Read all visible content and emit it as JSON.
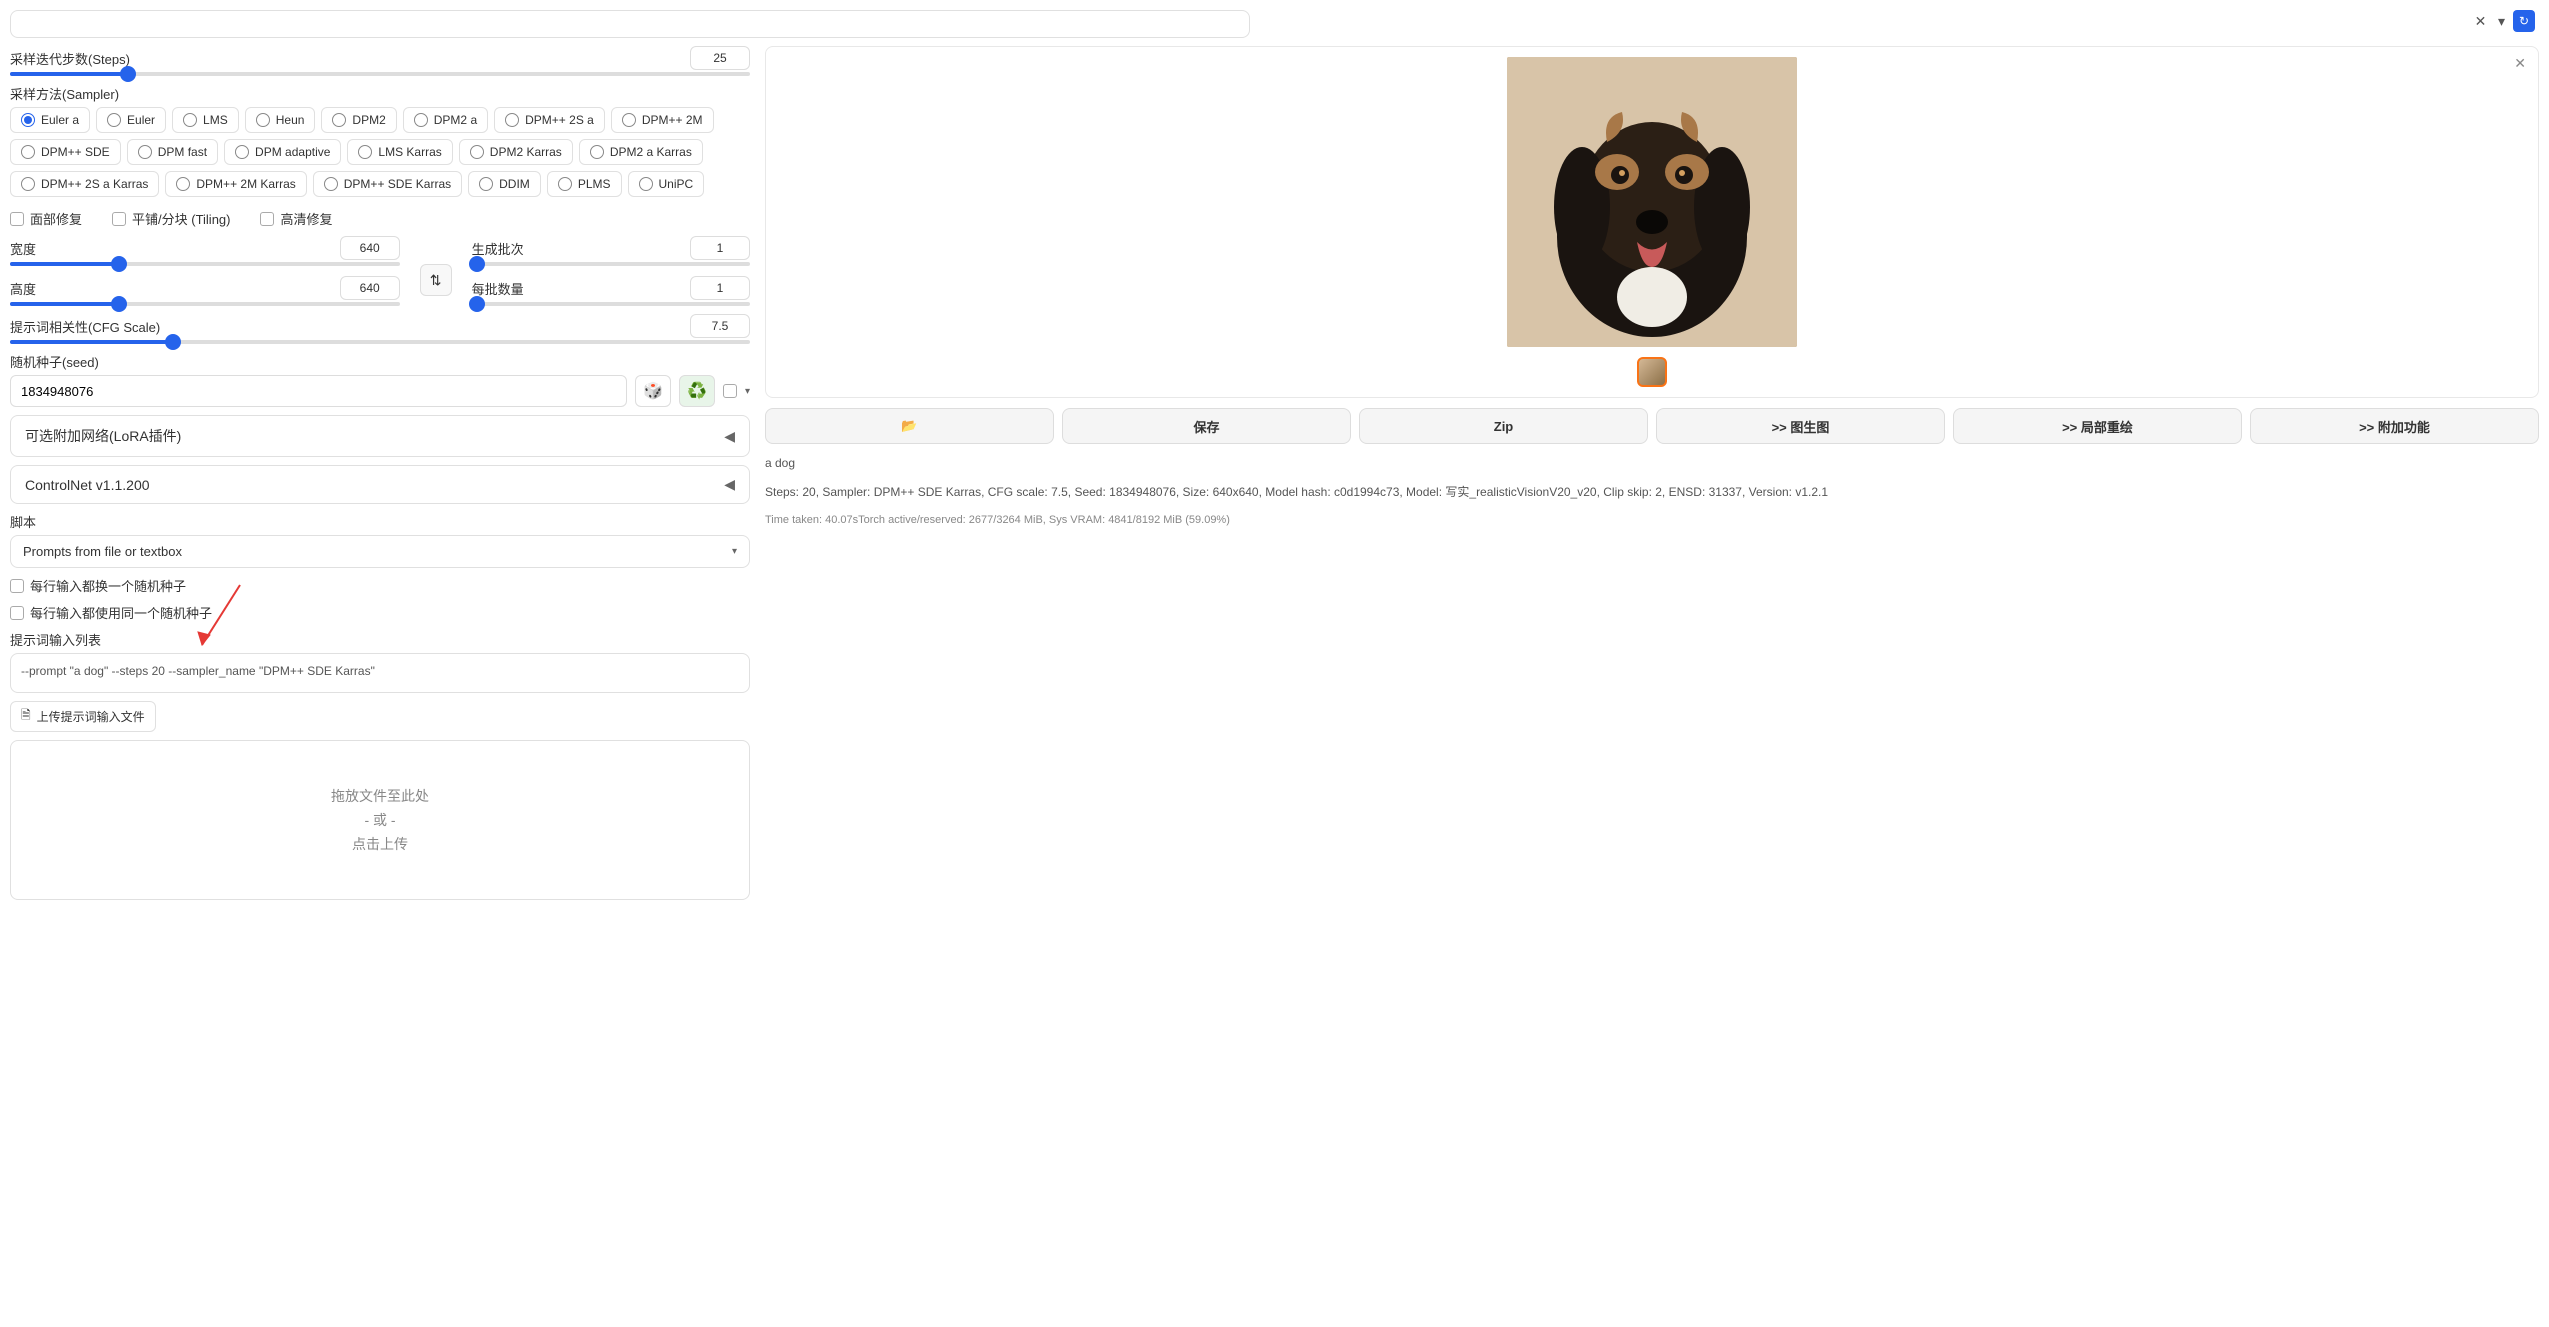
{
  "steps": {
    "label": "采样迭代步数(Steps)",
    "value": "25",
    "pct": 16
  },
  "sampler": {
    "label": "采样方法(Sampler)",
    "options": [
      "Euler a",
      "Euler",
      "LMS",
      "Heun",
      "DPM2",
      "DPM2 a",
      "DPM++ 2S a",
      "DPM++ 2M",
      "DPM++ SDE",
      "DPM fast",
      "DPM adaptive",
      "LMS Karras",
      "DPM2 Karras",
      "DPM2 a Karras",
      "DPM++ 2S a Karras",
      "DPM++ 2M Karras",
      "DPM++ SDE Karras",
      "DDIM",
      "PLMS",
      "UniPC"
    ],
    "selected": "Euler a"
  },
  "checks": {
    "face": "面部修复",
    "tiling": "平铺/分块 (Tiling)",
    "hires": "高清修复"
  },
  "width": {
    "label": "宽度",
    "value": "640",
    "pct": 28
  },
  "height": {
    "label": "高度",
    "value": "640",
    "pct": 28
  },
  "batch_count": {
    "label": "生成批次",
    "value": "1",
    "pct": 2
  },
  "batch_size": {
    "label": "每批数量",
    "value": "1",
    "pct": 2
  },
  "cfg": {
    "label": "提示词相关性(CFG Scale)",
    "value": "7.5",
    "pct": 22
  },
  "seed": {
    "label": "随机种子(seed)",
    "value": "1834948076"
  },
  "lora": "可选附加网络(LoRA插件)",
  "controlnet": "ControlNet v1.1.200",
  "script": {
    "label": "脚本",
    "value": "Prompts from file or textbox"
  },
  "script_opts": {
    "rand_each": "每行输入都换一个随机种子",
    "same_seed": "每行输入都使用同一个随机种子",
    "prompt_list_label": "提示词输入列表",
    "prompt_list_value": "--prompt \"a dog\" --steps 20 --sampler_name \"DPM++ SDE Karras\"",
    "upload": "上传提示词输入文件",
    "drop1": "拖放文件至此处",
    "drop2": "- 或 -",
    "drop3": "点击上传"
  },
  "actions": {
    "folder": "📂",
    "save": "保存",
    "zip": "Zip",
    "img2img": ">> 图生图",
    "inpaint": ">> 局部重绘",
    "extras": ">> 附加功能"
  },
  "output": {
    "prompt": "a dog",
    "meta": "Steps: 20, Sampler: DPM++ SDE Karras, CFG scale: 7.5, Seed: 1834948076, Size: 640x640, Model hash: c0d1994c73, Model: 写实_realisticVisionV20_v20, Clip skip: 2, ENSD: 31337, Version: v1.2.1",
    "time": "Time taken: 40.07sTorch active/reserved: 2677/3264 MiB, Sys VRAM: 4841/8192 MiB (59.09%)"
  }
}
